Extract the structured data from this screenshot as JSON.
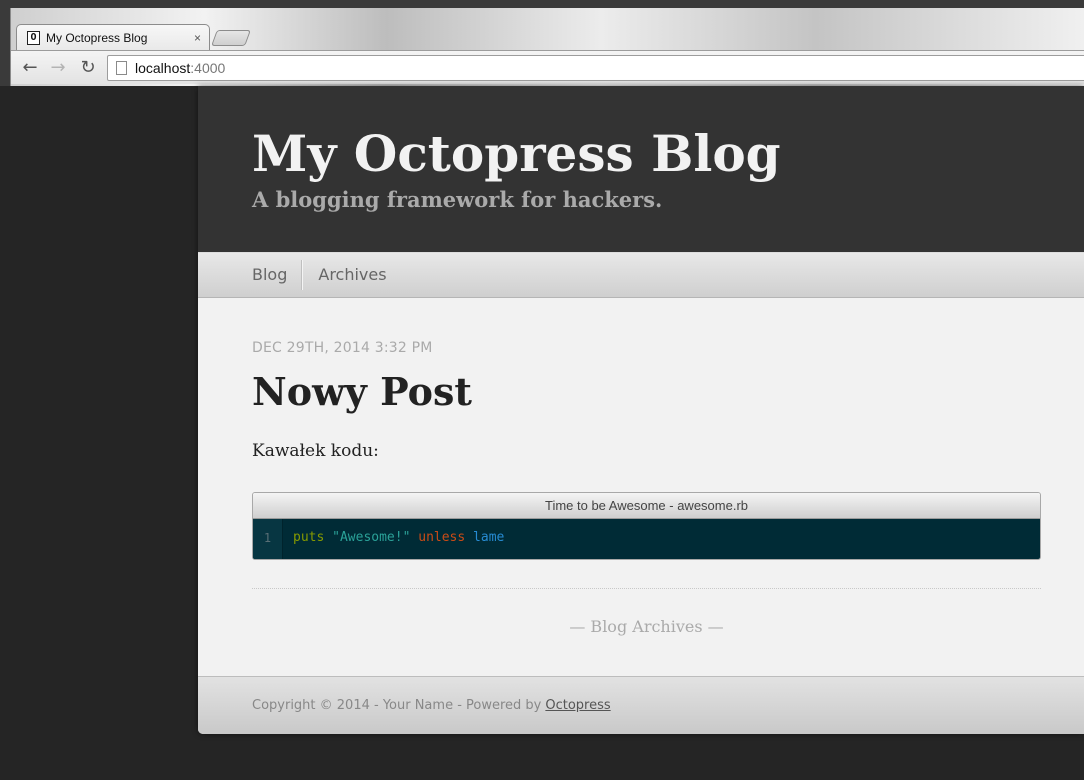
{
  "browser": {
    "tab_favicon": "O",
    "tab_title": "My Octopress Blog",
    "tab_close": "×",
    "back_glyph": "←",
    "forward_glyph": "→",
    "reload_glyph": "↻",
    "url_host": "localhost",
    "url_port": ":4000"
  },
  "header": {
    "title": "My Octopress Blog",
    "subtitle": "A blogging framework for hackers."
  },
  "nav": {
    "items": [
      {
        "label": "Blog"
      },
      {
        "label": "Archives"
      }
    ]
  },
  "post": {
    "date": "DEC 29TH, 2014 3:32 PM",
    "title": "Nowy Post",
    "body": "Kawałek kodu:",
    "code": {
      "caption": "Time to be Awesome - awesome.rb",
      "line_number": "1",
      "tokens": {
        "func": "puts",
        "string": "\"Awesome!\"",
        "keyword": "unless",
        "ident": "lame"
      }
    }
  },
  "archives_link": "— Blog Archives —",
  "footer": {
    "text": "Copyright © 2014 - Your Name - Powered by",
    "link": "Octopress"
  },
  "colors": {
    "header_bg": "#333333",
    "code_bg": "#002b36",
    "code_func": "#859900",
    "code_string": "#2aa198",
    "code_keyword": "#cb4b16",
    "code_ident": "#268bd2"
  }
}
